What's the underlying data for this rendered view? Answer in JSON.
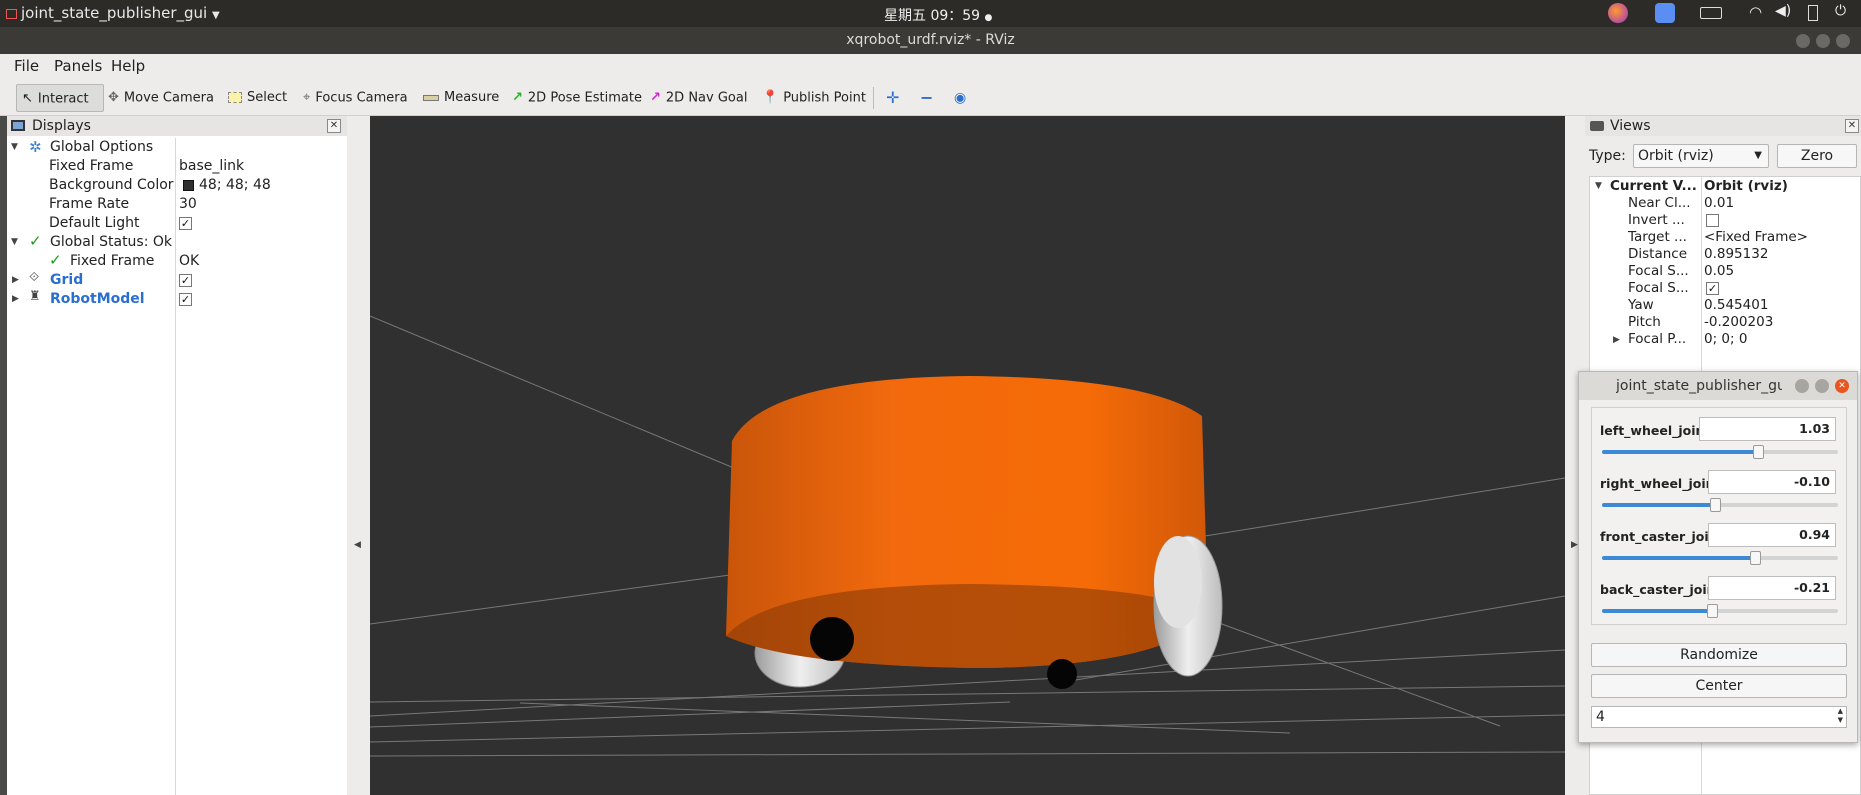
{
  "system": {
    "app_menu": "joint_state_publisher_gui",
    "clock": "星期五 09：59"
  },
  "window": {
    "title": "xqrobot_urdf.rviz* - RViz"
  },
  "menubar": {
    "file": "File",
    "panels": "Panels",
    "help": "Help"
  },
  "toolbar": {
    "interact": "Interact",
    "move_camera": "Move Camera",
    "select": "Select",
    "focus_camera": "Focus Camera",
    "measure": "Measure",
    "pose_estimate": "2D Pose Estimate",
    "nav_goal": "2D Nav Goal",
    "publish_point": "Publish Point"
  },
  "displays": {
    "title": "Displays",
    "global_options": "Global Options",
    "fixed_frame_label": "Fixed Frame",
    "fixed_frame_value": "base_link",
    "bg_color_label": "Background Color",
    "bg_color_value": "48; 48; 48",
    "bg_color_swatch": "#303030",
    "frame_rate_label": "Frame Rate",
    "frame_rate_value": "30",
    "default_light_label": "Default Light",
    "global_status": "Global Status: Ok",
    "status_fixed_frame": "Fixed Frame",
    "status_fixed_frame_value": "OK",
    "grid": "Grid",
    "robot_model": "RobotModel"
  },
  "views": {
    "title": "Views",
    "type_label": "Type:",
    "type_value": "Orbit (rviz)",
    "zero_button": "Zero",
    "current_view_label": "Current V...",
    "current_view_value": "Orbit (rviz)",
    "props": [
      {
        "label": "Near Cl...",
        "value": "0.01"
      },
      {
        "label": "Invert ...",
        "value": ""
      },
      {
        "label": "Target ...",
        "value": "<Fixed Frame>"
      },
      {
        "label": "Distance",
        "value": "0.895132"
      },
      {
        "label": "Focal S...",
        "value": "0.05"
      },
      {
        "label": "Focal S...",
        "value": ""
      },
      {
        "label": "Yaw",
        "value": "0.545401"
      },
      {
        "label": "Pitch",
        "value": "-0.200203"
      },
      {
        "label": "Focal P...",
        "value": "0; 0; 0"
      }
    ]
  },
  "joint_gui": {
    "title": "joint_state_publisher_gui",
    "joints": [
      {
        "name": "left_wheel_joint",
        "value": "1.03",
        "level": 0.66
      },
      {
        "name": "right_wheel_joint",
        "value": "-0.10",
        "level": 0.48
      },
      {
        "name": "front_caster_joint",
        "value": "0.94",
        "level": 0.65
      },
      {
        "name": "back_caster_joint",
        "value": "-0.21",
        "level": 0.465
      }
    ],
    "randomize": "Randomize",
    "center": "Center",
    "spin_value": "4"
  },
  "colors": {
    "robot_body": "#f26a0d",
    "viewport_bg": "#303030",
    "link_blue": "#2a6fd0",
    "slider_blue": "#3c8ad6"
  }
}
